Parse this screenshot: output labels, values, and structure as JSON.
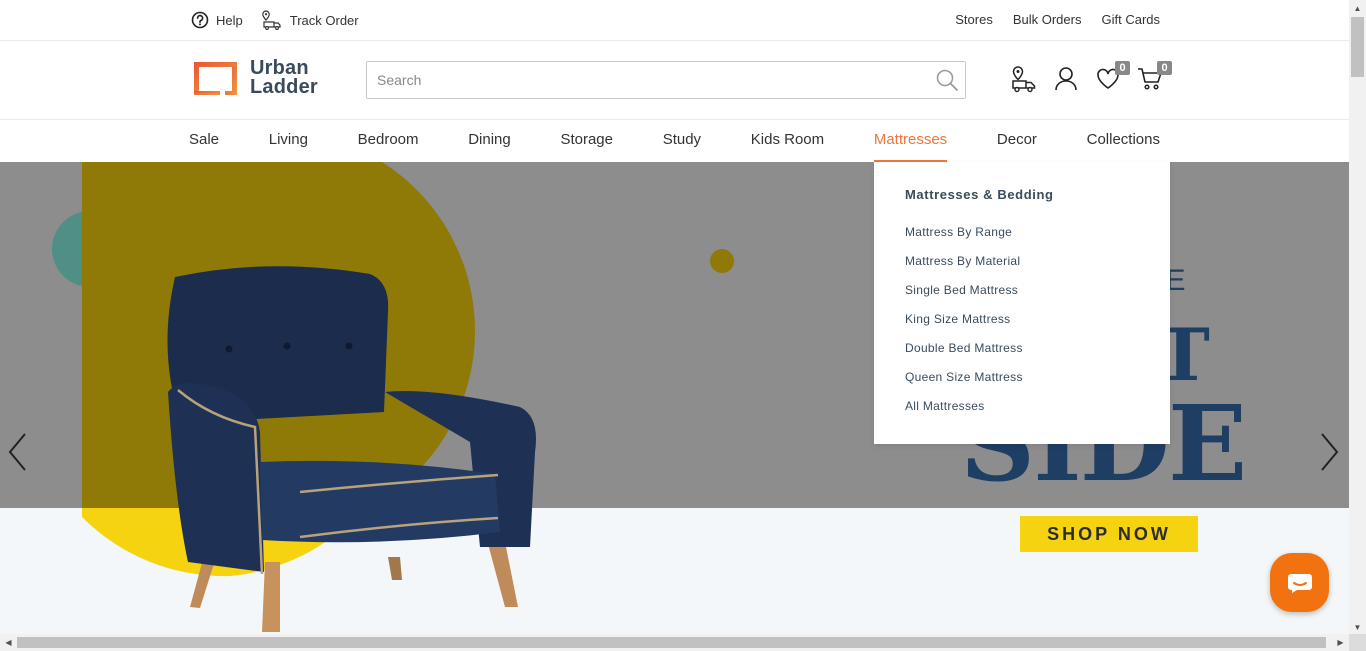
{
  "topbar": {
    "help": "Help",
    "track_order": "Track Order",
    "stores": "Stores",
    "bulk_orders": "Bulk Orders",
    "gift_cards": "Gift Cards"
  },
  "brand": {
    "line1": "Urban",
    "line2": "Ladder",
    "colors": {
      "orange": "#f1743d",
      "text": "#3a4b5c"
    }
  },
  "search": {
    "placeholder": "Search",
    "value": ""
  },
  "header_icons": {
    "wishlist_count": "0",
    "cart_count": "0"
  },
  "nav": {
    "items": [
      "Sale",
      "Living",
      "Bedroom",
      "Dining",
      "Storage",
      "Study",
      "Kids Room",
      "Mattresses",
      "Decor",
      "Collections"
    ],
    "active": "Mattresses"
  },
  "dropdown": {
    "heading": "Mattresses & Bedding",
    "items": [
      "Mattress By Range",
      "Mattress By Material",
      "Single Bed Mattress",
      "King Size Mattress",
      "Double Bed Mattress",
      "Queen Size Mattress",
      "All Mattresses"
    ]
  },
  "hero": {
    "line1": "D THE",
    "line2": "IGHT",
    "line3": "SIDE",
    "cta": "SHOP NOW",
    "colors": {
      "yellow": "#f5d311",
      "navy": "#1f3e63"
    }
  },
  "icons": [
    "help-icon",
    "track-order-icon",
    "search-icon",
    "store-locator-icon",
    "user-icon",
    "wishlist-icon",
    "cart-icon",
    "chevron-left-icon",
    "chevron-right-icon",
    "chat-icon"
  ]
}
